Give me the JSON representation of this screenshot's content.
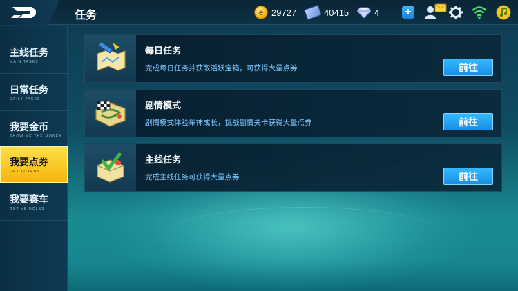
{
  "header": {
    "title": "任务",
    "resources": {
      "coins": "29727",
      "tickets": "40415",
      "gems": "4"
    },
    "icons": [
      "add-icon",
      "mail-icon",
      "settings-icon",
      "wifi-icon",
      "music-icon"
    ]
  },
  "sidebar": {
    "items": [
      {
        "label": "主线任务",
        "sub": "MAIN TASKS",
        "active": false
      },
      {
        "label": "日常任务",
        "sub": "DAILY TASKS",
        "active": false
      },
      {
        "label": "我要金币",
        "sub": "SHOW ME THE MONEY",
        "active": false
      },
      {
        "label": "我要点券",
        "sub": "GET TOKENS",
        "active": true
      },
      {
        "label": "我要赛车",
        "sub": "GET VEHICLES",
        "active": false
      }
    ]
  },
  "tasks": [
    {
      "name": "每日任务",
      "desc": "完成每日任务并获取活跃宝箱，可获得大量点券",
      "button": "前往",
      "icon": "map-icon"
    },
    {
      "name": "剧情模式",
      "desc": "剧情模式体验车神成长，挑战剧情关卡获得大量点券",
      "button": "前往",
      "icon": "race-track-icon"
    },
    {
      "name": "主线任务",
      "desc": "完成主线任务可获得大量点券",
      "button": "前往",
      "icon": "checklist-icon"
    }
  ],
  "colors": {
    "accent_blue": "#1a8ee8",
    "active_tab": "#f5b40a",
    "desc_text": "#7fc7ff"
  }
}
